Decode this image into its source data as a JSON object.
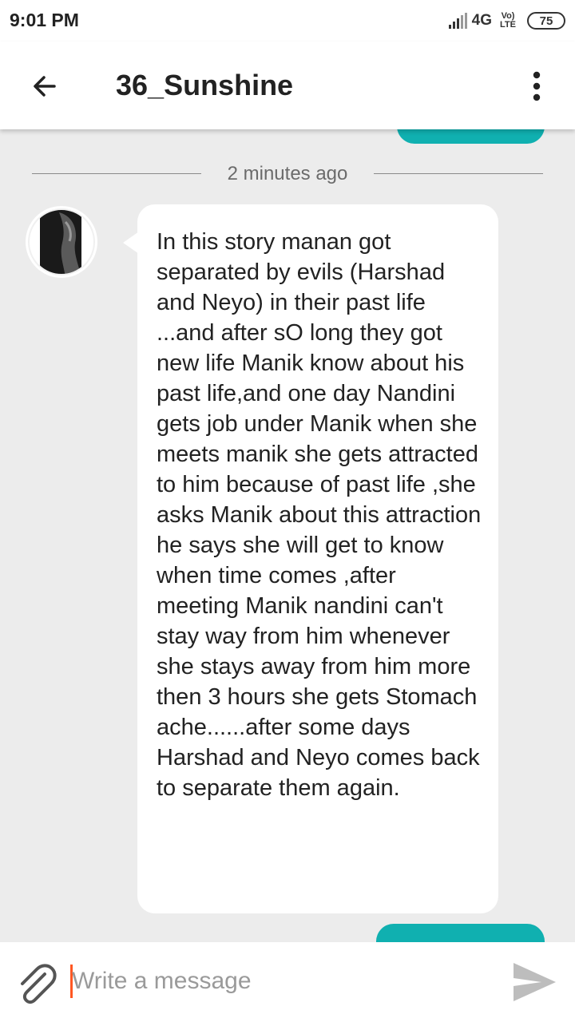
{
  "status_bar": {
    "time": "9:01 PM",
    "network": "4G",
    "network_sub": "Vo)",
    "lte": "LTE",
    "battery": "75"
  },
  "header": {
    "title": "36_Sunshine",
    "back_icon": "arrow-left-icon",
    "menu_icon": "more-vert-icon"
  },
  "conversation": {
    "time_divider": "2 minutes ago",
    "messages": [
      {
        "direction": "incoming",
        "text": "In this story manan got separated by evils (Harshad and Neyo) in their past life ...and after sO long they got new life Manik know about his past life,and one day Nandini gets job under Manik  when she meets manik she gets attracted to him because of past life ,she asks Manik about this attraction he says she will get to know when time comes ,after meeting Manik nandini can't stay way from him whenever she stays away from him more then 3 hours she gets Stomach ache......after some days Harshad and Neyo comes back to separate them again."
      }
    ]
  },
  "composer": {
    "placeholder": "Write a message",
    "value": "",
    "attach_icon": "paperclip-icon",
    "send_icon": "send-icon"
  },
  "colors": {
    "accent": "#10b0b0",
    "cursor": "#ff5722",
    "background": "#ececec"
  }
}
